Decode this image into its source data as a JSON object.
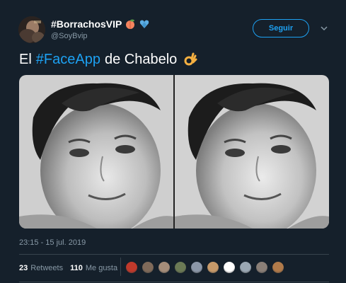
{
  "author": {
    "display_name": "#BorrachosVIP",
    "handle": "@SoyBvip",
    "emoji_icons": [
      "peach-icon",
      "blue-heart-icon"
    ]
  },
  "follow_button": {
    "label": "Seguir",
    "color": "#1da1f2"
  },
  "tweet": {
    "text_before": "El",
    "hashtag": "#FaceApp",
    "text_after": "de Chabelo",
    "emoji_icon": "ok-hand-icon"
  },
  "media": {
    "count": 2,
    "description_icons": [
      "photo-original",
      "photo-faceapp"
    ]
  },
  "timestamp": "23:15 - 15 jul. 2019",
  "stats": {
    "retweets_count": "23",
    "retweets_label": "Retweets",
    "likes_count": "110",
    "likes_label": "Me gusta"
  },
  "likers": [
    {
      "color": "#c0392b"
    },
    {
      "color": "#7f6a5a"
    },
    {
      "color": "#a58d7a"
    },
    {
      "color": "#6b7a55"
    },
    {
      "color": "#8b97a8"
    },
    {
      "color": "#c79a6a"
    },
    {
      "color": "#ffffff"
    },
    {
      "color": "#9aa7b3"
    },
    {
      "color": "#8a7f77"
    },
    {
      "color": "#b07a4a"
    }
  ],
  "colors": {
    "background": "#15202b",
    "accent": "#1da1f2",
    "secondary_text": "#8899a6",
    "divider": "#38444d"
  }
}
